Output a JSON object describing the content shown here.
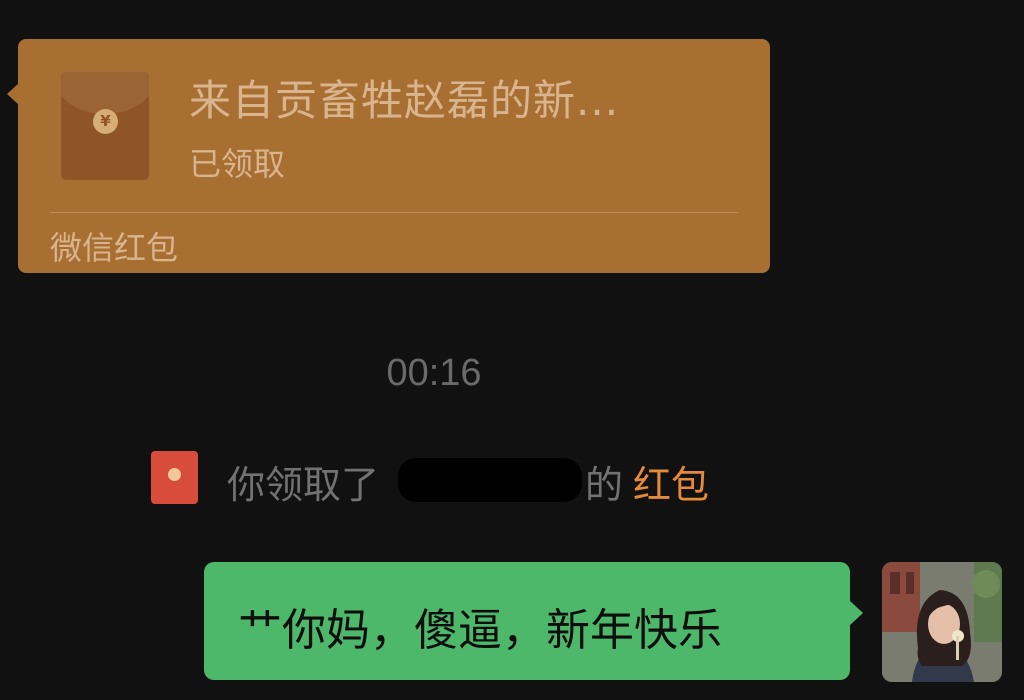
{
  "red_packet": {
    "title": "来自贡畜牲赵磊的新...",
    "status": "已领取",
    "source": "微信红包",
    "coin_glyph": "¥"
  },
  "timestamp": "00:16",
  "system_notice": {
    "prefix": "你领取了",
    "suffix": "的",
    "link": "红包"
  },
  "message": {
    "text": "艹你妈，傻逼，新年快乐"
  },
  "colors": {
    "background": "#111112",
    "red_packet_bubble": "#a86f33",
    "outgoing_bubble": "#4db86a",
    "link": "#e58a3a",
    "notice_icon": "#d84c3c"
  }
}
